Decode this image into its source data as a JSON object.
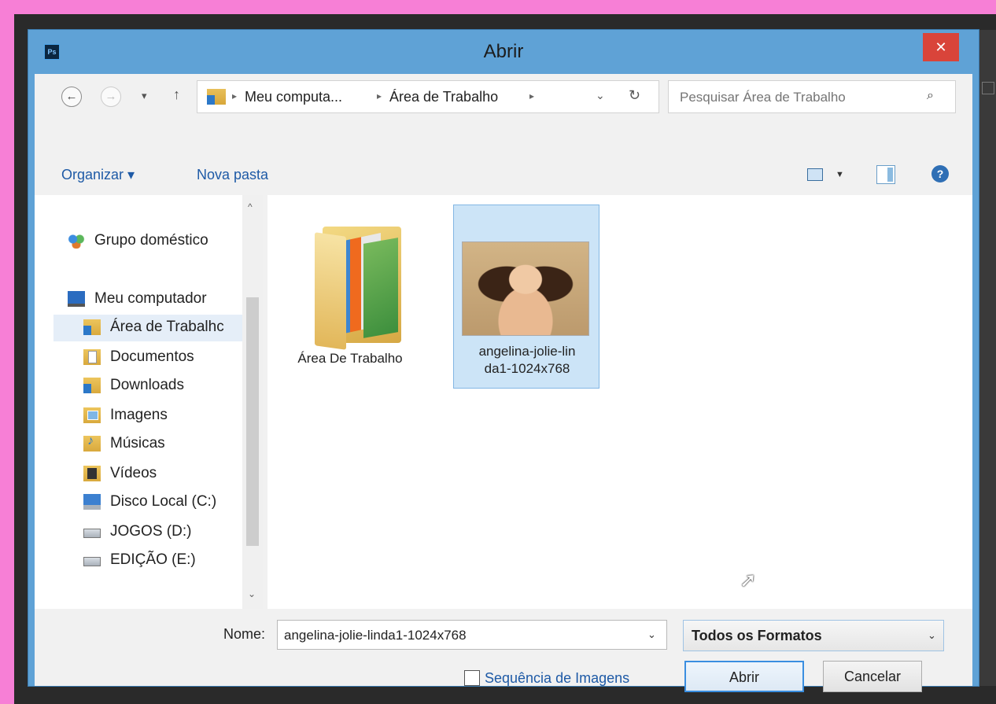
{
  "window": {
    "title": "Abrir",
    "app_icon_text": "Ps",
    "close_glyph": "✕"
  },
  "navigation": {
    "back_glyph": "←",
    "forward_glyph": "→",
    "recent_glyph": "▾",
    "up_glyph": "↑",
    "breadcrumbs": [
      "Meu computa...",
      "Área de Trabalho"
    ],
    "separator_glyph": "▸",
    "refresh_glyph": "↻",
    "dropdown_glyph": "⌄"
  },
  "search": {
    "placeholder": "Pesquisar Área de Trabalho",
    "icon_glyph": "⌕"
  },
  "toolbar": {
    "organize_label": "Organizar ▾",
    "new_folder_label": "Nova pasta",
    "view_caret": "▼",
    "help_glyph": "?"
  },
  "nav_pane": {
    "items": [
      {
        "label": "Grupo doméstico",
        "icon": "homegroup-icon"
      },
      {
        "label": "Meu computador",
        "icon": "computer-icon"
      },
      {
        "label": "Área de Trabalhc",
        "icon": "desktop-folder-icon",
        "selected": true
      },
      {
        "label": "Documentos",
        "icon": "documents-folder-icon"
      },
      {
        "label": "Downloads",
        "icon": "downloads-folder-icon"
      },
      {
        "label": "Imagens",
        "icon": "pictures-folder-icon"
      },
      {
        "label": "Músicas",
        "icon": "music-folder-icon"
      },
      {
        "label": "Vídeos",
        "icon": "videos-folder-icon"
      },
      {
        "label": "Disco Local (C:)",
        "icon": "local-disk-icon"
      },
      {
        "label": "JOGOS (D:)",
        "icon": "drive-icon"
      },
      {
        "label": "EDIÇÃO (E:)",
        "icon": "drive-icon"
      }
    ],
    "scroll_up_glyph": "^",
    "scroll_down_glyph": "⌄"
  },
  "files": [
    {
      "name": "Área De Trabalho",
      "type": "folder",
      "icon": "folder-icon"
    },
    {
      "name_line1": "angelina-jolie-lin",
      "name_line2": "da1-1024x768",
      "type": "image",
      "selected": true,
      "icon": "image-thumbnail"
    }
  ],
  "bottom": {
    "name_label": "Nome:",
    "filename_value": "angelina-jolie-linda1-1024x768",
    "chevron_glyph": "⌄",
    "format_value": "Todos os Formatos",
    "sequence_label": "Sequência de Imagens",
    "sequence_checked": false,
    "open_label": "Abrir",
    "cancel_label": "Cancelar"
  },
  "colors": {
    "background": "#f77fd6",
    "frame": "#5fa2d6",
    "close": "#d9443a",
    "link": "#1e5aa6",
    "selection": "#cce4f7"
  }
}
